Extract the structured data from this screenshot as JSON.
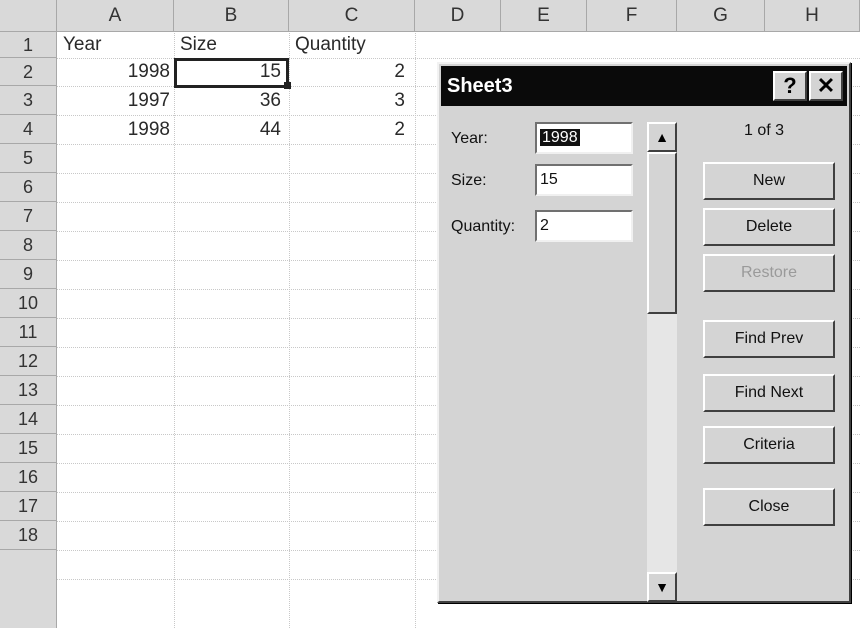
{
  "columns": [
    "A",
    "B",
    "C",
    "D",
    "E",
    "F",
    "G",
    "H"
  ],
  "rows": [
    "1",
    "2",
    "3",
    "4",
    "5",
    "6",
    "7",
    "8",
    "9",
    "10",
    "11",
    "12",
    "13",
    "14",
    "15",
    "16",
    "17",
    "18"
  ],
  "cells": {
    "A1": "Year",
    "B1": "Size",
    "C1": "Quantity",
    "A2": "1998",
    "B2": "15",
    "C2": "2",
    "A3": "1997",
    "B3": "36",
    "C3": "3",
    "A4": "1998",
    "B4": "44",
    "C4": "2"
  },
  "dialog": {
    "title": "Sheet3",
    "help_glyph": "?",
    "close_glyph": "✕",
    "record_info": "1 of 3",
    "fields": [
      {
        "label": "Year:",
        "value": "1998"
      },
      {
        "label": "Size:",
        "value": "15"
      },
      {
        "label": "Quantity:",
        "value": "2"
      }
    ],
    "buttons": {
      "new": "New",
      "delete": "Delete",
      "restore": "Restore",
      "find_prev": "Find Prev",
      "find_next": "Find Next",
      "criteria": "Criteria",
      "close": "Close"
    },
    "scroll_up_glyph": "▲",
    "scroll_down_glyph": "▼"
  }
}
